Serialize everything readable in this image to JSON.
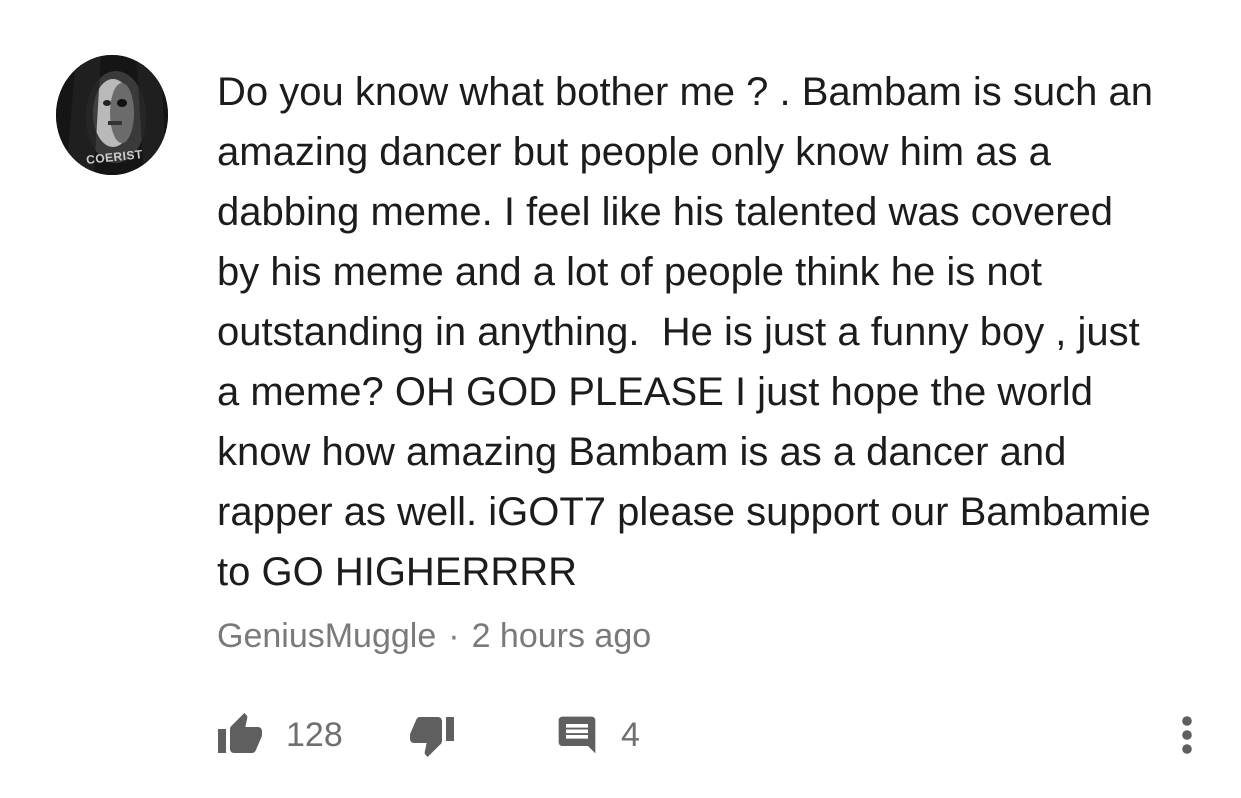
{
  "comment": {
    "avatar_label": "COERIST",
    "text": "Do you know what bother me ? . Bambam is such an\namazing dancer but people only know him as a\ndabbing meme. I feel like his talented was covered\nby his meme and a lot of people think he is not\noutstanding in anything.  He is just a funny boy , just\na meme? OH GOD PLEASE I just hope the world\nknow how amazing Bambam is as a dancer and\nrapper as well. iGOT7 please support our Bambamie\nto GO HIGHERRRR",
    "author": "GeniusMuggle",
    "separator": "·",
    "timestamp": "2 hours ago"
  },
  "actions": {
    "like_icon": "thumbs-up-icon",
    "like_count": "128",
    "dislike_icon": "thumbs-down-icon",
    "reply_icon": "comment-icon",
    "reply_count": "4",
    "more_icon": "more-vertical-icon"
  },
  "colors": {
    "text": "#1c1c1c",
    "meta": "#7a7a7a",
    "icon": "#5f5f5f"
  }
}
